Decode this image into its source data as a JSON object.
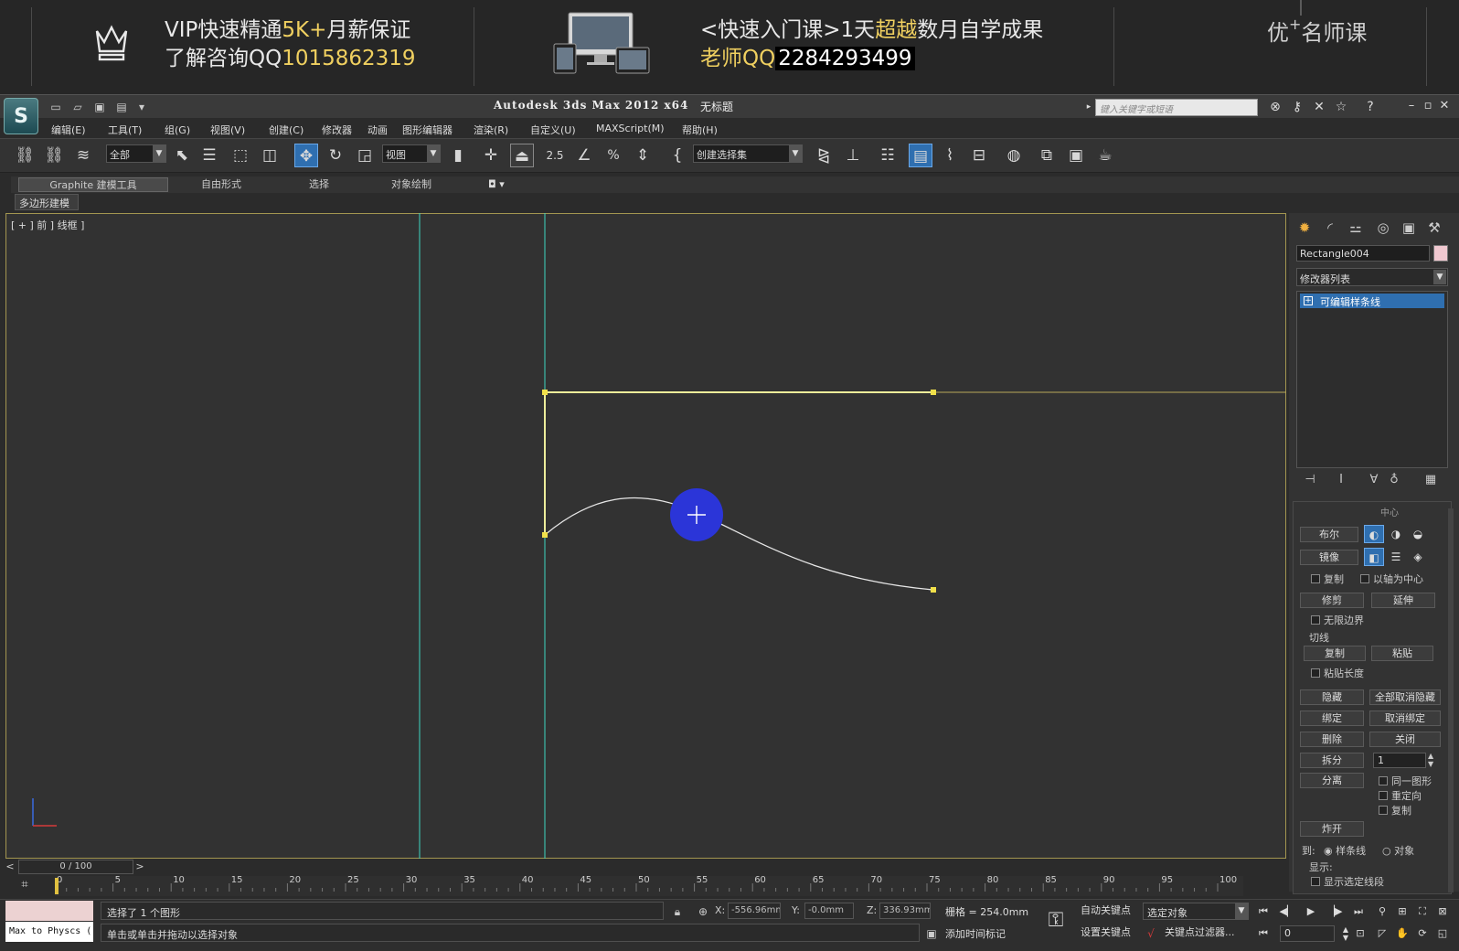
{
  "banner": {
    "left_line1_pre": "VIP快速精通",
    "left_line1_hl": "5K+",
    "left_line1_post": "月薪保证",
    "left_line2_pre": "了解咨询QQ",
    "left_line2_hl": "1015862319",
    "right_line1_pre": "<快速入门课>1天",
    "right_line1_hl": "超越",
    "right_line1_post": "数月自学成果",
    "right_line2_hl": "老师QQ",
    "right_line2_box": "2284293499",
    "brand_pre": "优",
    "brand_sup": "+",
    "brand_post": "名师课"
  },
  "titlebar": {
    "app_title": "Autodesk 3ds Max  2012 x64",
    "doc_title": "无标题",
    "search_placeholder": "键入关键字或短语"
  },
  "menu": [
    {
      "label": "编辑(E)"
    },
    {
      "label": "工具(T)"
    },
    {
      "label": "组(G)"
    },
    {
      "label": "视图(V)"
    },
    {
      "label": "创建(C)"
    },
    {
      "label": "修改器"
    },
    {
      "label": "动画"
    },
    {
      "label": "图形编辑器"
    },
    {
      "label": "渲染(R)"
    },
    {
      "label": "自定义(U)"
    },
    {
      "label": "MAXScript(M)"
    },
    {
      "label": "帮助(H)"
    }
  ],
  "toolbar": {
    "filter_value": "全部",
    "ref_coord_value": "视图",
    "snap_label": "2.5",
    "named_sel_value": "创建选择集"
  },
  "ribbon": {
    "tabs": [
      "Graphite 建模工具",
      "自由形式",
      "选择",
      "对象绘制"
    ],
    "sub": "多边形建模"
  },
  "viewport": {
    "label": "[ + ] 前 ] 线框 ]",
    "colors": {
      "guide": "#3fd7c2",
      "selected_line": "#ecec9a",
      "grid_line": "#b8a85a",
      "curve": "#e6e6e6",
      "vertex": "#f1e04a",
      "cursor_disc": "#2b35d8"
    }
  },
  "command_panel": {
    "object_name": "Rectangle004",
    "modifier_list": "修改器列表",
    "stack_item": "可编辑样条线",
    "buttons": {
      "boolean": "布尔",
      "mirror": "镜像",
      "copy_chk": "复制",
      "axis_chk": "以轴为中心",
      "trim": "修剪",
      "extend": "延伸",
      "infinite_chk": "无限边界",
      "tangent_group": "切线",
      "t_copy": "复制",
      "t_paste": "粘贴",
      "paste_len_chk": "粘贴长度",
      "hide": "隐藏",
      "unhide_all": "全部取消隐藏",
      "bind": "绑定",
      "unbind": "取消绑定",
      "delete": "删除",
      "close": "关闭",
      "divide": "拆分",
      "divide_value": "1",
      "detach": "分离",
      "same_shape_chk": "同一图形",
      "reorient_chk": "重定向",
      "copy2_chk": "复制",
      "explode": "炸开",
      "to_label": "到:",
      "to_spline": "样条线",
      "to_object": "对象",
      "display_group": "显示:",
      "show_seg_chk": "显示选定线段",
      "center_cut": "中心"
    }
  },
  "timeline": {
    "slider_text": "0 / 100",
    "ticks": [
      0,
      5,
      10,
      15,
      20,
      25,
      30,
      35,
      40,
      45,
      50,
      55,
      60,
      65,
      70,
      75,
      80,
      85,
      90,
      95,
      100
    ]
  },
  "status": {
    "listener": "Max to Physcs (",
    "line1": "选择了 1 个图形",
    "line2": "单击或单击并拖动以选择对象",
    "x_label": "X:",
    "x_value": "-556.96mm",
    "y_label": "Y:",
    "y_value": "-0.0mm",
    "z_label": "Z:",
    "z_value": "336.93mm",
    "grid": "栅格 = 254.0mm",
    "add_time_tag": "添加时间标记",
    "auto_key": "自动关键点",
    "set_key": "设置关键点",
    "selection": "选定对象",
    "key_filters": "关键点过滤器...",
    "frame": "0"
  }
}
